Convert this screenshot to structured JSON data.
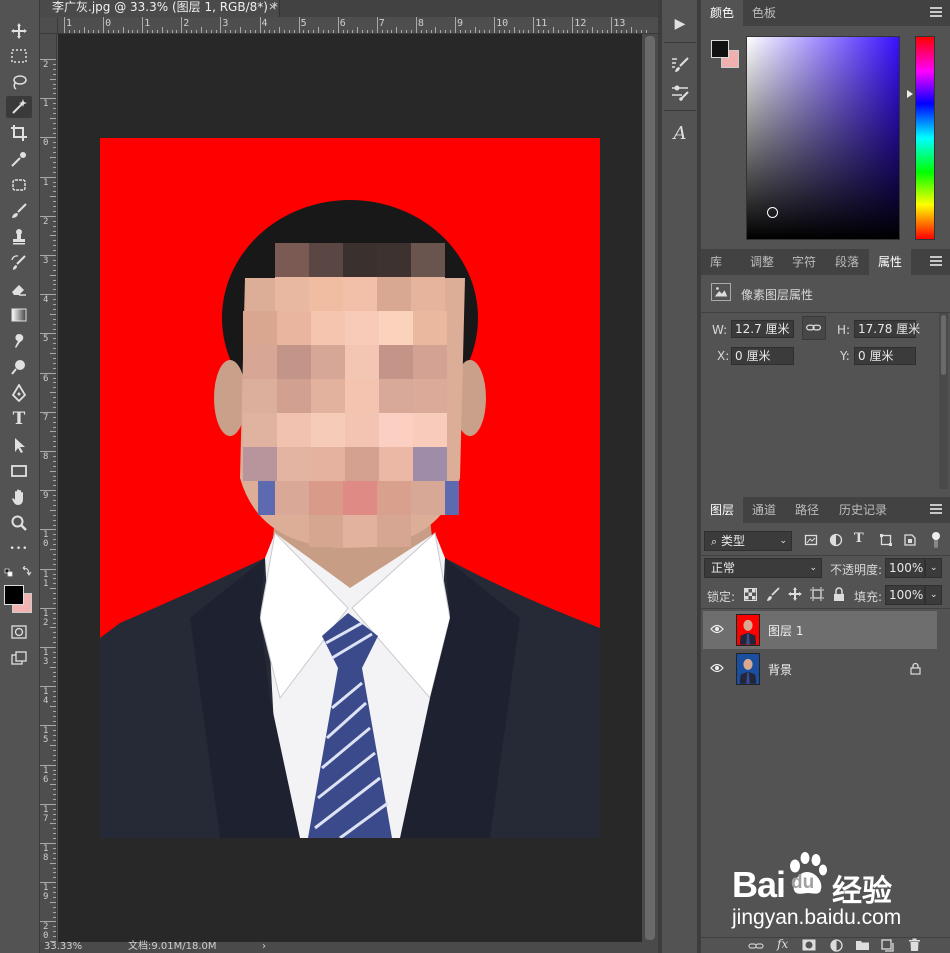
{
  "document": {
    "tab_title": "李广灰.jpg @ 33.3% (图层 1, RGB/8*) *",
    "close_symbol": "×",
    "zoom": "33.33%",
    "doc_size": "文档:9.01M/18.0M",
    "status_arrow": "›"
  },
  "ruler": {
    "top_labels": [
      "1",
      "0",
      "1",
      "2",
      "3",
      "4",
      "5",
      "6",
      "7",
      "8",
      "9",
      "10",
      "11",
      "12",
      "13"
    ],
    "left_labels": [
      "2",
      "1",
      "0",
      "1",
      "2",
      "3",
      "4",
      "5",
      "6",
      "7",
      "8",
      "9",
      "10",
      "11",
      "12",
      "13",
      "14",
      "15",
      "16",
      "17",
      "18",
      "19",
      "20"
    ]
  },
  "toolbar": {
    "tools": [
      "move-tool",
      "marquee-tool",
      "lasso-tool",
      "magic-wand-tool",
      "crop-tool",
      "eyedropper-tool",
      "patch-tool",
      "brush-tool",
      "stamp-tool",
      "history-brush-tool",
      "eraser-tool",
      "gradient-tool",
      "smudge-tool",
      "dodge-tool",
      "pen-tool",
      "type-tool",
      "path-select-tool",
      "rectangle-tool",
      "hand-tool",
      "zoom-tool",
      "more-tools"
    ],
    "type_glyph": "T",
    "more_glyph": "•••",
    "foreground_color": "#000000",
    "background_color": "#f2b3b3"
  },
  "color_panel": {
    "tabs": [
      "颜色",
      "色板"
    ],
    "foreground_color": "#111111",
    "background_color": "#f0b0b0",
    "hue_color": "#3a10ff"
  },
  "properties_panel": {
    "tabs": [
      "库",
      "调整",
      "字符",
      "段落",
      "属性"
    ],
    "title": "像素图层属性",
    "w_label": "W:",
    "w_value": "12.7 厘米",
    "h_label": "H:",
    "h_value": "17.78 厘米",
    "x_label": "X:",
    "x_value": "0 厘米",
    "y_label": "Y:",
    "y_value": "0 厘米"
  },
  "layers_panel": {
    "tabs": [
      "图层",
      "通道",
      "路径",
      "历史记录"
    ],
    "filter_label": "类型",
    "blend_mode": "正常",
    "opacity_label": "不透明度:",
    "opacity_value": "100%",
    "lock_label": "锁定:",
    "fill_label": "填充:",
    "fill_value": "100%",
    "layers": [
      {
        "name": "图层 1",
        "selected": true,
        "bg": "#ff0000"
      },
      {
        "name": "背景",
        "selected": false,
        "bg": "#1a4fa0",
        "locked": true
      }
    ],
    "fx_label": "fx"
  },
  "middock": {
    "type_glyph": "A",
    "play_glyph": "▶"
  },
  "watermark": {
    "brand_bai": "Bai",
    "brand_du": "du",
    "brand_cn": "经验",
    "url": "jingyan.baidu.com"
  }
}
